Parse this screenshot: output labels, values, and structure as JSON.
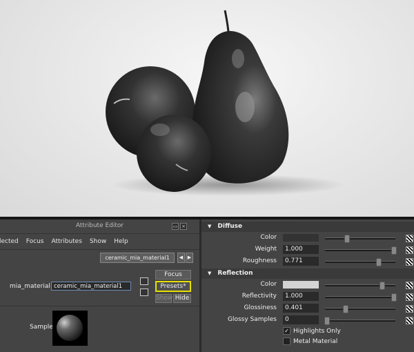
{
  "attribute_editor": {
    "title": "Attribute Editor",
    "menu": [
      "lected",
      "Focus",
      "Attributes",
      "Show",
      "Help"
    ],
    "node_tab": "ceramic_mia_material1",
    "tab_prev": "◀",
    "tab_next": "▶",
    "node_type_label": "mia_material:",
    "node_name_value": "ceramic_mia_material1",
    "focus_label": "Focus",
    "presets_label": "Presets*",
    "show_label": "Show",
    "hide_label": "Hide",
    "sample_label": "Sample"
  },
  "diffuse": {
    "header": "Diffuse",
    "color": {
      "label": "Color",
      "value": "#333333",
      "level": 0.3
    },
    "weight": {
      "label": "Weight",
      "value": "1.000",
      "level": 0.97
    },
    "roughness": {
      "label": "Roughness",
      "value": "0.771",
      "level": 0.75
    }
  },
  "reflection": {
    "header": "Reflection",
    "color": {
      "label": "Color",
      "value": "#d4d4d4",
      "level": 0.8
    },
    "reflectivity": {
      "label": "Reflectivity",
      "value": "1.000",
      "level": 0.97
    },
    "glossiness": {
      "label": "Glossiness",
      "value": "0.401",
      "level": 0.28
    },
    "glossy_samples": {
      "label": "Glossy Samples",
      "value": "0",
      "level": 0.02
    },
    "highlights_only": {
      "label": "Highlights Only",
      "checked": true
    },
    "metal_material": {
      "label": "Metal Material",
      "checked": false
    }
  },
  "colors": {
    "presets_outline": "#e6e000",
    "field_focus": "#6d8fb8"
  }
}
